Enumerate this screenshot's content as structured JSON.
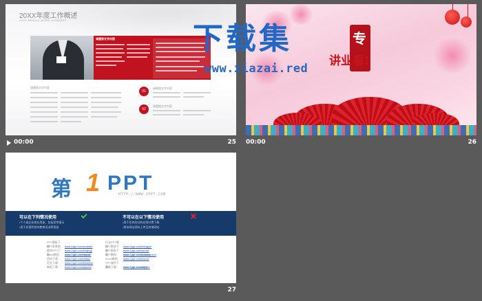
{
  "slides": [
    {
      "id": "25",
      "time": "00:00",
      "number": "25",
      "title": "20XX年度工作概述",
      "subtitle": "20XX ANNUAL WORK SUMMARY",
      "red_panel_heading": "请替换文字内容",
      "section_label": "请替换文字内容",
      "items": [
        {
          "num": "01",
          "label": "请替换文字内容"
        },
        {
          "num": "02",
          "label": "请替换文字内容"
        }
      ]
    },
    {
      "id": "26",
      "time": "00:00",
      "number": "26",
      "watermark_title": "下载集",
      "watermark_url": "www.xiazai.red",
      "badge_char": "专",
      "slogan": "讲业看!"
    },
    {
      "id": "27",
      "time": "",
      "number": "27",
      "logo_prefix": "第",
      "logo_one": "1",
      "logo_suffix": "PPT",
      "logo_url": "HTTP://WWW.1PPT.COM",
      "allowed_title": "可以在下列情况使用",
      "allowed_lines": [
        "•个人或企业商业用途，包括宣传演示",
        "•用于非营利性的教育培训等用途"
      ],
      "forbidden_title": "不可以在以下情况使用",
      "forbidden_lines": [
        "•用于任何形式的在线付费下载",
        "•把本网站资料上传至其他网站"
      ],
      "links_left": [
        {
          "label": "PPT模板下载：",
          "url": "www.1ppt.com/moban/"
        },
        {
          "label": "PPT背景图片：",
          "url": "www.1ppt.com/beijing/"
        },
        {
          "label": "优秀PPT下载：",
          "url": "www.1ppt.com/xiazai/"
        },
        {
          "label": "Word教程：",
          "url": "www.1ppt.com/word/"
        },
        {
          "label": "资料下载：",
          "url": "www.1ppt.com/ziliao/"
        },
        {
          "label": "范文下载：",
          "url": "www.1ppt.com/fanwen/"
        },
        {
          "label": "教案下载：",
          "url": "www.1ppt.com/jiaoan/"
        }
      ],
      "links_right": [
        {
          "label": "行业PPT模板：",
          "url": "www.1ppt.com/hangye/"
        },
        {
          "label": "PPT素材下载：",
          "url": "www.1ppt.com/sucai/"
        },
        {
          "label": "PPT图表下载：",
          "url": "www.1ppt.com/tubiao/"
        },
        {
          "label": "PPT教程：",
          "url": "www.1ppt.com/powerpoint/"
        },
        {
          "label": "Excel教程：",
          "url": "www.1ppt.com/excel/"
        },
        {
          "label": "PPT课件下载：",
          "url": "www.1ppt.com/kejian/"
        },
        {
          "label": "试卷下载：",
          "url": "www.1ppt.com/shiti/"
        }
      ]
    }
  ]
}
